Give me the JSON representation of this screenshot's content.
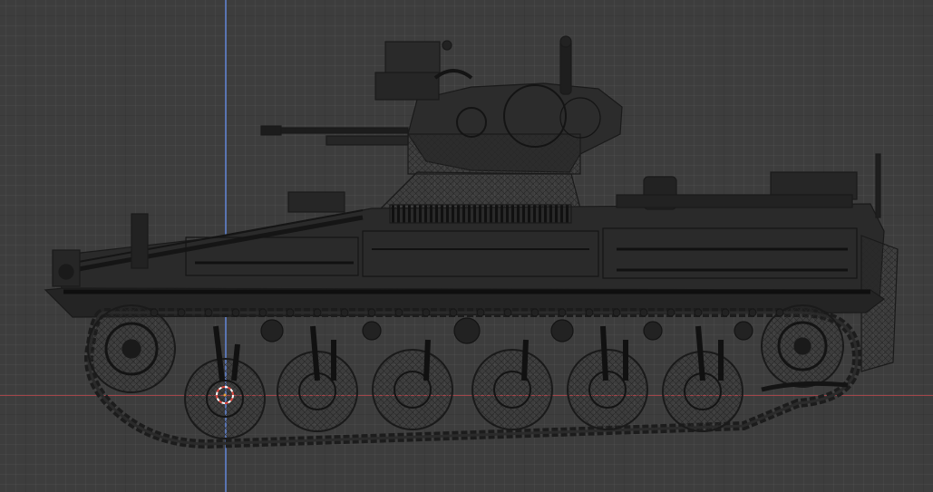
{
  "viewport": {
    "background_color": "#3d3d3d",
    "axis_colors": {
      "y": "#5f7fc7",
      "x": "#b4464c"
    },
    "wire_color": "#1a1a1a",
    "solid_color": "#262626"
  },
  "model": {
    "icon": "tracked-vehicle-wireframe",
    "view": "side"
  },
  "cursor": {
    "icon": "3d-cursor-icon",
    "colors": {
      "ring_light": "#ffffff",
      "ring_accent": "#e2463d"
    }
  }
}
